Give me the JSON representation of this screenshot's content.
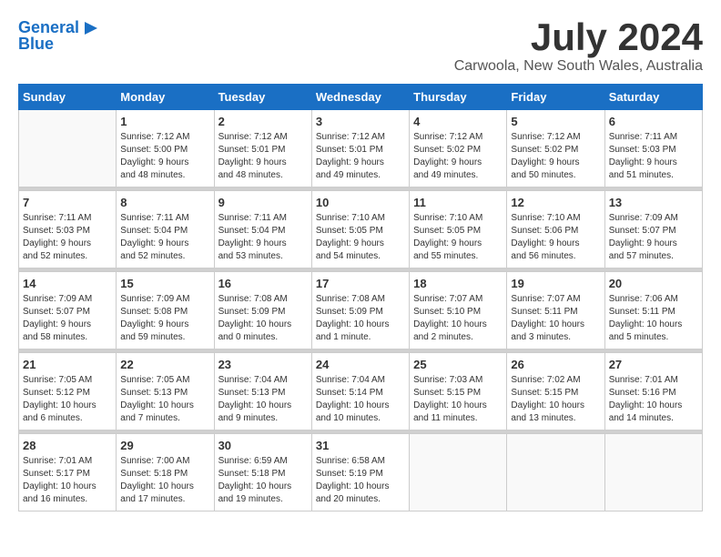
{
  "logo": {
    "line1": "General",
    "line2": "Blue",
    "arrow_color": "#1a6fc4"
  },
  "title": "July 2024",
  "location": "Carwoola, New South Wales, Australia",
  "header_color": "#1a6fc4",
  "days_of_week": [
    "Sunday",
    "Monday",
    "Tuesday",
    "Wednesday",
    "Thursday",
    "Friday",
    "Saturday"
  ],
  "weeks": [
    [
      {
        "day": "",
        "content": ""
      },
      {
        "day": "1",
        "content": "Sunrise: 7:12 AM\nSunset: 5:00 PM\nDaylight: 9 hours\nand 48 minutes."
      },
      {
        "day": "2",
        "content": "Sunrise: 7:12 AM\nSunset: 5:01 PM\nDaylight: 9 hours\nand 48 minutes."
      },
      {
        "day": "3",
        "content": "Sunrise: 7:12 AM\nSunset: 5:01 PM\nDaylight: 9 hours\nand 49 minutes."
      },
      {
        "day": "4",
        "content": "Sunrise: 7:12 AM\nSunset: 5:02 PM\nDaylight: 9 hours\nand 49 minutes."
      },
      {
        "day": "5",
        "content": "Sunrise: 7:12 AM\nSunset: 5:02 PM\nDaylight: 9 hours\nand 50 minutes."
      },
      {
        "day": "6",
        "content": "Sunrise: 7:11 AM\nSunset: 5:03 PM\nDaylight: 9 hours\nand 51 minutes."
      }
    ],
    [
      {
        "day": "7",
        "content": "Sunrise: 7:11 AM\nSunset: 5:03 PM\nDaylight: 9 hours\nand 52 minutes."
      },
      {
        "day": "8",
        "content": "Sunrise: 7:11 AM\nSunset: 5:04 PM\nDaylight: 9 hours\nand 52 minutes."
      },
      {
        "day": "9",
        "content": "Sunrise: 7:11 AM\nSunset: 5:04 PM\nDaylight: 9 hours\nand 53 minutes."
      },
      {
        "day": "10",
        "content": "Sunrise: 7:10 AM\nSunset: 5:05 PM\nDaylight: 9 hours\nand 54 minutes."
      },
      {
        "day": "11",
        "content": "Sunrise: 7:10 AM\nSunset: 5:05 PM\nDaylight: 9 hours\nand 55 minutes."
      },
      {
        "day": "12",
        "content": "Sunrise: 7:10 AM\nSunset: 5:06 PM\nDaylight: 9 hours\nand 56 minutes."
      },
      {
        "day": "13",
        "content": "Sunrise: 7:09 AM\nSunset: 5:07 PM\nDaylight: 9 hours\nand 57 minutes."
      }
    ],
    [
      {
        "day": "14",
        "content": "Sunrise: 7:09 AM\nSunset: 5:07 PM\nDaylight: 9 hours\nand 58 minutes."
      },
      {
        "day": "15",
        "content": "Sunrise: 7:09 AM\nSunset: 5:08 PM\nDaylight: 9 hours\nand 59 minutes."
      },
      {
        "day": "16",
        "content": "Sunrise: 7:08 AM\nSunset: 5:09 PM\nDaylight: 10 hours\nand 0 minutes."
      },
      {
        "day": "17",
        "content": "Sunrise: 7:08 AM\nSunset: 5:09 PM\nDaylight: 10 hours\nand 1 minute."
      },
      {
        "day": "18",
        "content": "Sunrise: 7:07 AM\nSunset: 5:10 PM\nDaylight: 10 hours\nand 2 minutes."
      },
      {
        "day": "19",
        "content": "Sunrise: 7:07 AM\nSunset: 5:11 PM\nDaylight: 10 hours\nand 3 minutes."
      },
      {
        "day": "20",
        "content": "Sunrise: 7:06 AM\nSunset: 5:11 PM\nDaylight: 10 hours\nand 5 minutes."
      }
    ],
    [
      {
        "day": "21",
        "content": "Sunrise: 7:05 AM\nSunset: 5:12 PM\nDaylight: 10 hours\nand 6 minutes."
      },
      {
        "day": "22",
        "content": "Sunrise: 7:05 AM\nSunset: 5:13 PM\nDaylight: 10 hours\nand 7 minutes."
      },
      {
        "day": "23",
        "content": "Sunrise: 7:04 AM\nSunset: 5:13 PM\nDaylight: 10 hours\nand 9 minutes."
      },
      {
        "day": "24",
        "content": "Sunrise: 7:04 AM\nSunset: 5:14 PM\nDaylight: 10 hours\nand 10 minutes."
      },
      {
        "day": "25",
        "content": "Sunrise: 7:03 AM\nSunset: 5:15 PM\nDaylight: 10 hours\nand 11 minutes."
      },
      {
        "day": "26",
        "content": "Sunrise: 7:02 AM\nSunset: 5:15 PM\nDaylight: 10 hours\nand 13 minutes."
      },
      {
        "day": "27",
        "content": "Sunrise: 7:01 AM\nSunset: 5:16 PM\nDaylight: 10 hours\nand 14 minutes."
      }
    ],
    [
      {
        "day": "28",
        "content": "Sunrise: 7:01 AM\nSunset: 5:17 PM\nDaylight: 10 hours\nand 16 minutes."
      },
      {
        "day": "29",
        "content": "Sunrise: 7:00 AM\nSunset: 5:18 PM\nDaylight: 10 hours\nand 17 minutes."
      },
      {
        "day": "30",
        "content": "Sunrise: 6:59 AM\nSunset: 5:18 PM\nDaylight: 10 hours\nand 19 minutes."
      },
      {
        "day": "31",
        "content": "Sunrise: 6:58 AM\nSunset: 5:19 PM\nDaylight: 10 hours\nand 20 minutes."
      },
      {
        "day": "",
        "content": ""
      },
      {
        "day": "",
        "content": ""
      },
      {
        "day": "",
        "content": ""
      }
    ]
  ]
}
